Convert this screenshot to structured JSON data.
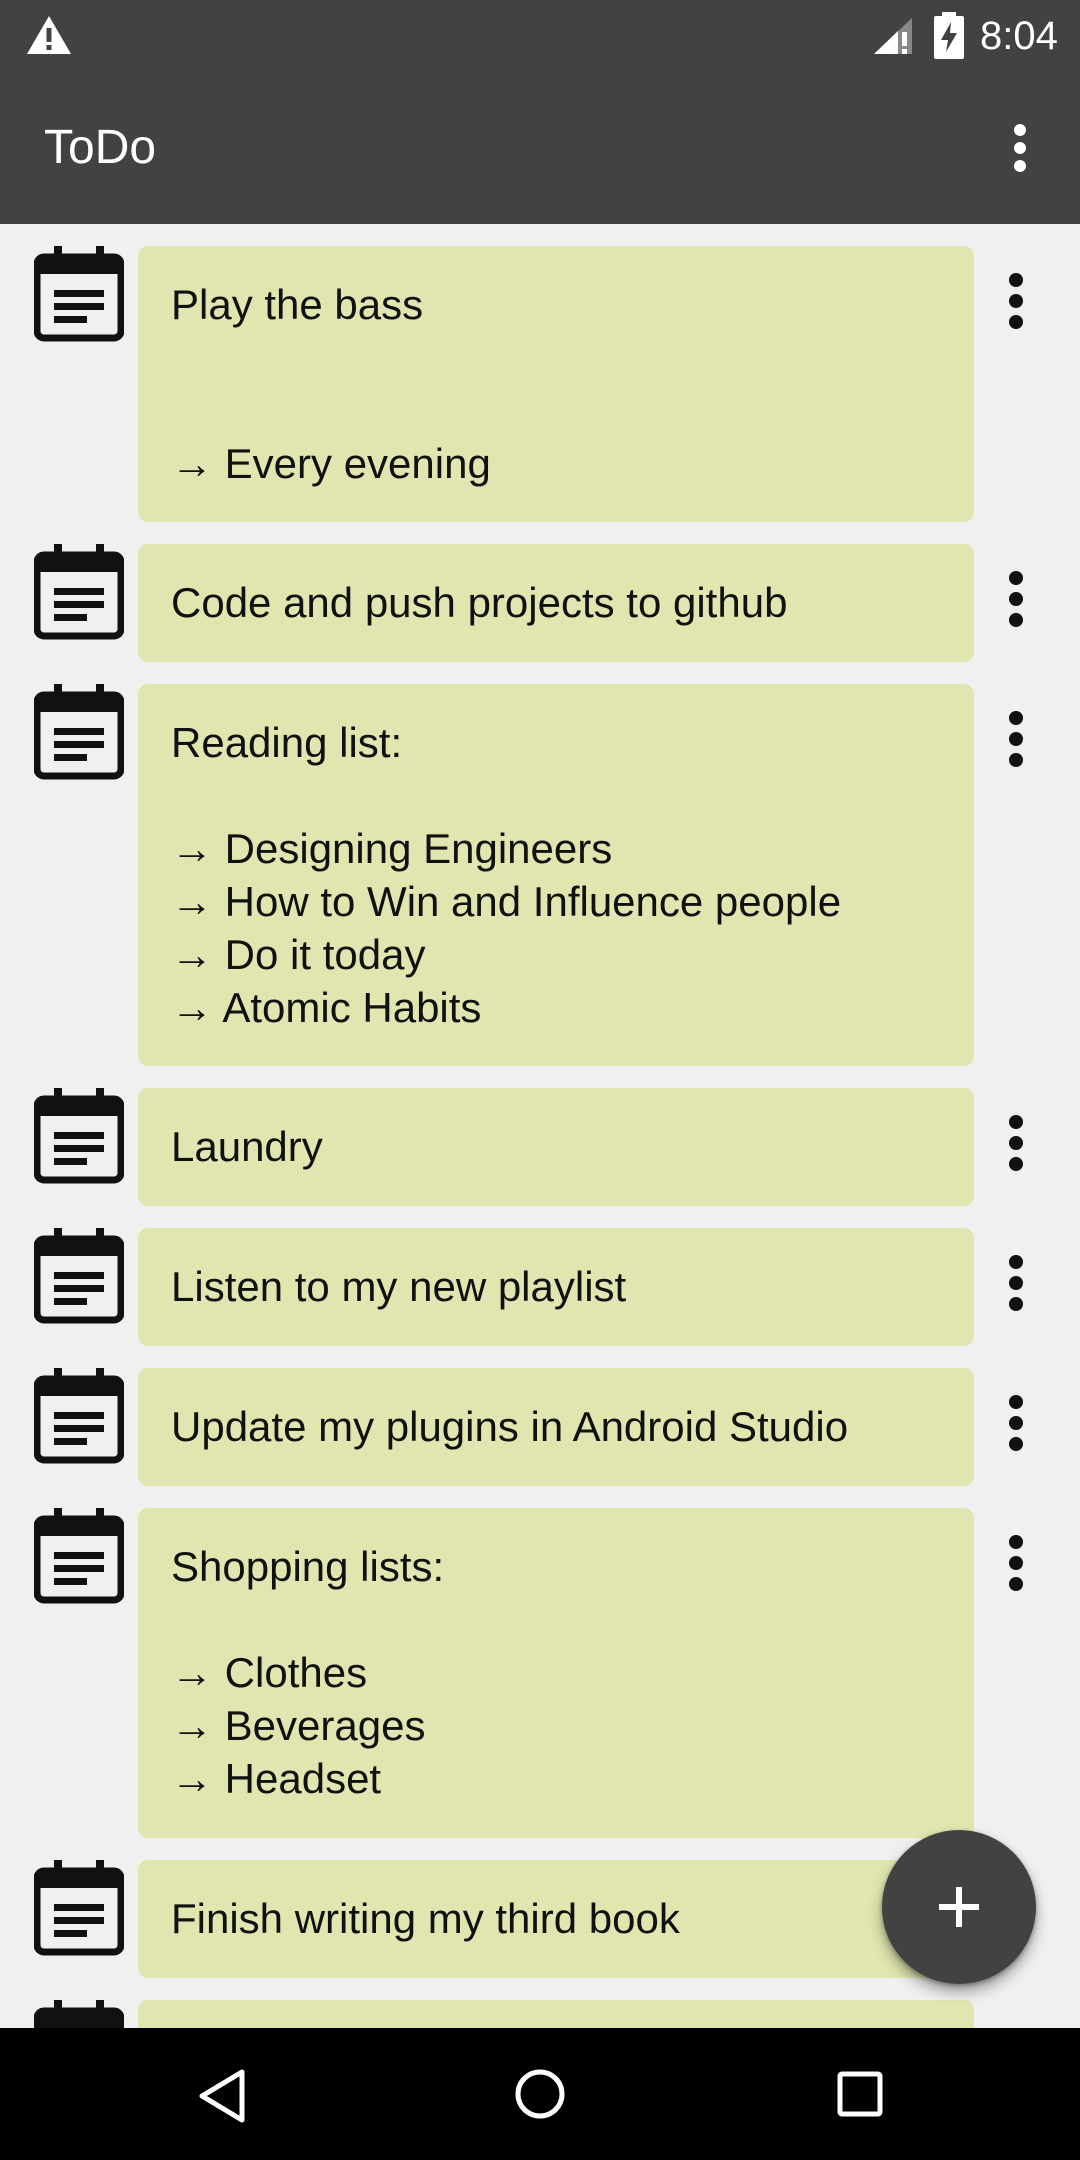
{
  "status_bar": {
    "time": "8:04",
    "icons": [
      "warning-icon",
      "signal-icon",
      "battery-charging-icon"
    ]
  },
  "app_bar": {
    "title": "ToDo",
    "menu_icon": "more-vert-icon"
  },
  "todos": [
    {
      "text": "Play the bass\n\n\n→ Every evening",
      "icon": "calendar-note-icon"
    },
    {
      "text": "Code and push projects to github",
      "icon": "calendar-note-icon"
    },
    {
      "text": "Reading list:\n\n→ Designing Engineers\n→ How to Win and Influence people\n→ Do it today\n→ Atomic Habits",
      "icon": "calendar-note-icon"
    },
    {
      "text": "Laundry",
      "icon": "calendar-note-icon"
    },
    {
      "text": "Listen to my new playlist",
      "icon": "calendar-note-icon"
    },
    {
      "text": "Update my plugins in Android Studio",
      "icon": "calendar-note-icon"
    },
    {
      "text": "Shopping lists:\n\n→ Clothes\n→ Beverages\n→ Headset",
      "icon": "calendar-note-icon"
    },
    {
      "text": "Finish writing my third book",
      "icon": "calendar-note-icon"
    },
    {
      "text": "",
      "icon": "calendar-note-icon"
    }
  ],
  "fab": {
    "icon": "add-icon"
  },
  "nav_bar": {
    "icons": [
      "back-icon",
      "home-icon",
      "recents-icon"
    ]
  },
  "colors": {
    "bar": "#424242",
    "card": "#e1e6b0",
    "background": "#f0f0f0"
  }
}
